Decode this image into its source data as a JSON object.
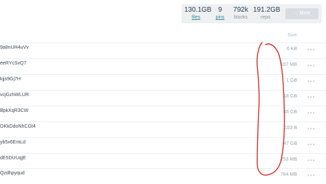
{
  "stats": {
    "files": {
      "value": "130.1GB",
      "label": "files"
    },
    "pins": {
      "value": "9",
      "label": "pins"
    },
    "blocks": {
      "value": "792k",
      "label": "blocks"
    },
    "repo": {
      "value": "191.2GB",
      "label": "repo"
    },
    "more_button": "··· More"
  },
  "table": {
    "size_header": "Size",
    "rows": [
      {
        "cid": "9a8nUH4uVv",
        "size": "6 KB"
      },
      {
        "cid": "eeRYcSvQ7",
        "size": "167 MB"
      },
      {
        "cid": "kjjs9Gj7H",
        "size": "1 GB"
      },
      {
        "cid": "vcjGzhWLUR",
        "size": "18 GB"
      },
      {
        "cid": "BpkXqR3CW",
        "size": "46 GB"
      },
      {
        "cid": "OKkDdoNhCGt4",
        "size": "103 B"
      },
      {
        "cid": "yb5x6EmLd",
        "size": "47 GB"
      },
      {
        "cid": "dE5DUUqjE",
        "size": "253 MB"
      },
      {
        "cid": "Qzdhpyqud",
        "size": "784 MB"
      }
    ],
    "row_menu": "•••"
  },
  "annotation": {
    "color": "#d42a2a"
  }
}
